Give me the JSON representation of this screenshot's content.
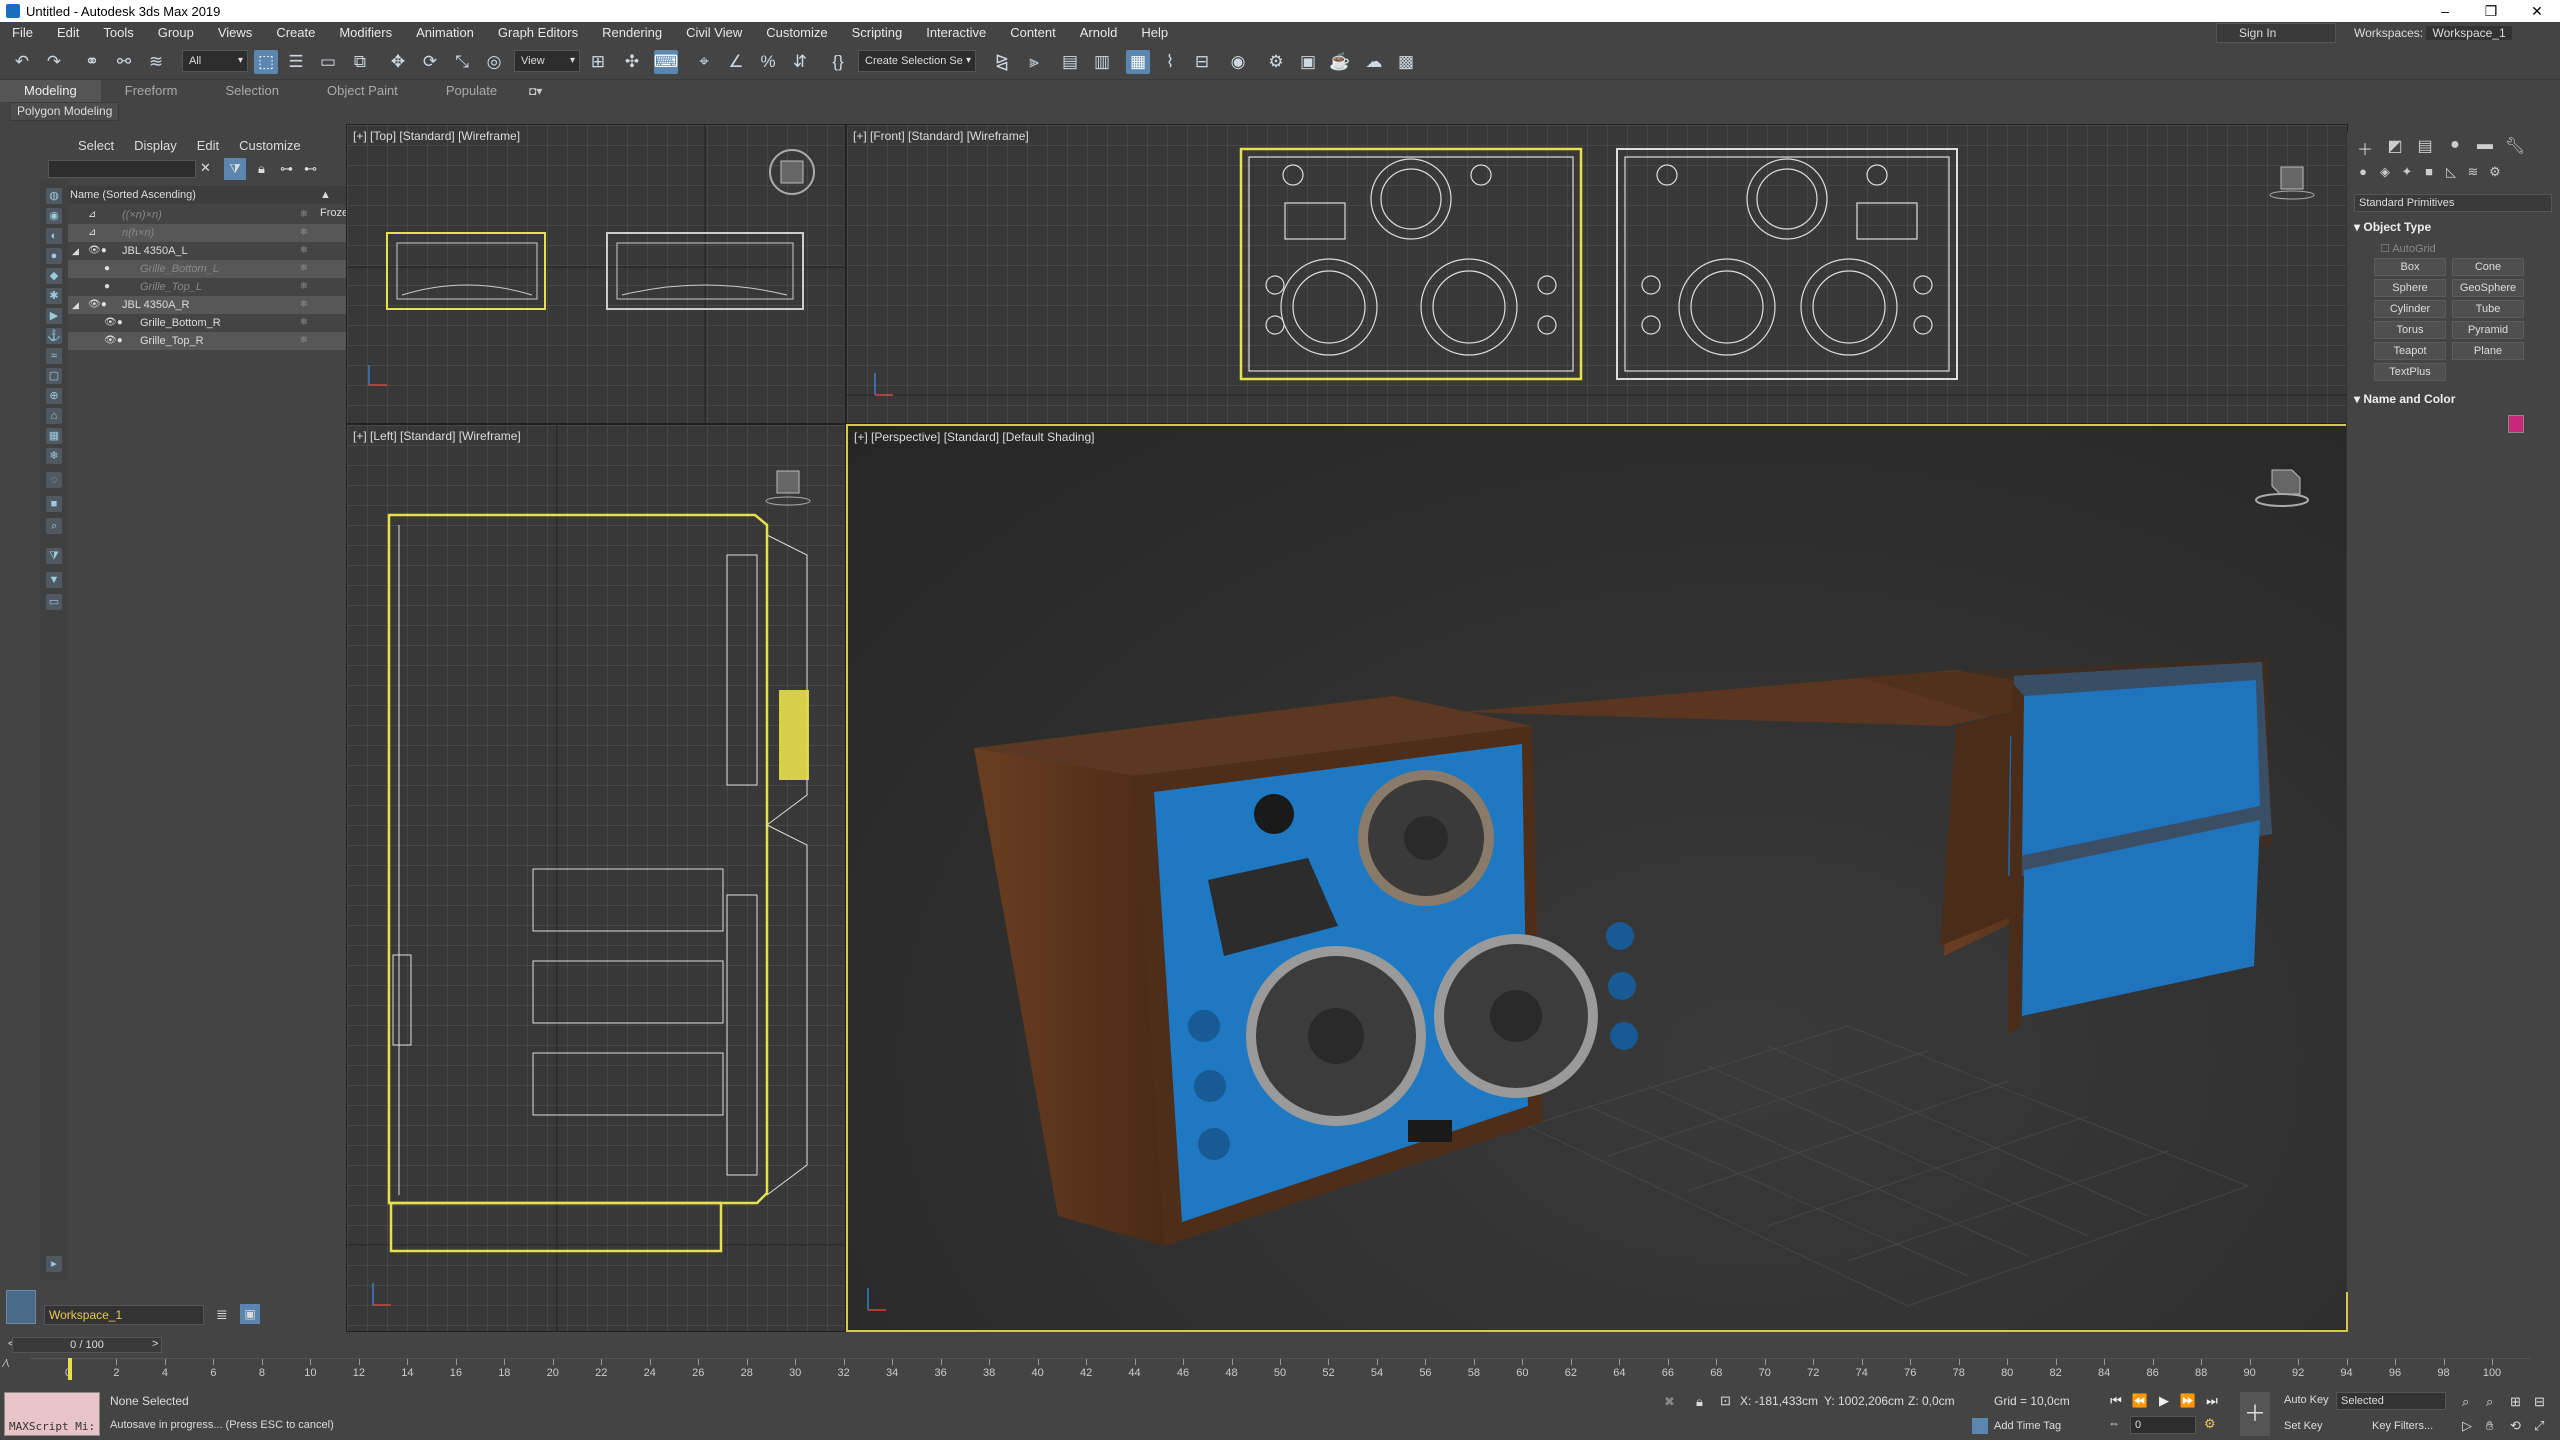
{
  "window": {
    "title": "Untitled - Autodesk 3ds Max 2019",
    "minimize": "–",
    "maximize": "❐",
    "close": "✕"
  },
  "menu": [
    "File",
    "Edit",
    "Tools",
    "Group",
    "Views",
    "Create",
    "Modifiers",
    "Animation",
    "Graph Editors",
    "Rendering",
    "Civil View",
    "Customize",
    "Scripting",
    "Interactive",
    "Content",
    "Arnold",
    "Help"
  ],
  "account": {
    "sign_in": "Sign In",
    "workspaces_label": "Workspaces:",
    "workspace": "Workspace_1"
  },
  "toolbar": {
    "selection_filter": "All",
    "ref_coord": "View",
    "named_selection": "Create Selection Se"
  },
  "ribbon": {
    "tabs": [
      "Modeling",
      "Freeform",
      "Selection",
      "Object Paint",
      "Populate"
    ],
    "active": "Modeling",
    "sub": "Polygon Modeling"
  },
  "scene_explorer": {
    "tabs": [
      "Select",
      "Display",
      "Edit",
      "Customize"
    ],
    "col_name": "Name (Sorted Ascending)",
    "col_frozen": "▲ Frozen",
    "rows": [
      {
        "label": "((×n)×n)",
        "dim": true
      },
      {
        "label": "n(h×n)",
        "dim": true
      },
      {
        "label": "JBL 4350A_L",
        "dim": false
      },
      {
        "label": "Grille_Bottom_L",
        "dim": true
      },
      {
        "label": "Grille_Top_L",
        "dim": true
      },
      {
        "label": "JBL 4350A_R",
        "dim": false
      },
      {
        "label": "Grille_Bottom_R",
        "dim": false
      },
      {
        "label": "Grille_Top_R",
        "dim": false
      }
    ],
    "workspace": "Workspace_1"
  },
  "viewports": {
    "top": "[+] [Top] [Standard] [Wireframe]",
    "front": "[+] [Front] [Standard] [Wireframe]",
    "left": "[+] [Left] [Standard] [Wireframe]",
    "persp": "[+] [Perspective] [Standard] [Default Shading]"
  },
  "command_panel": {
    "dropdown": "Standard Primitives",
    "object_type": "Object Type",
    "autogrid": "AutoGrid",
    "buttons": [
      "Box",
      "Cone",
      "Sphere",
      "GeoSphere",
      "Cylinder",
      "Tube",
      "Torus",
      "Pyramid",
      "Teapot",
      "Plane",
      "TextPlus"
    ],
    "name_color": "Name and Color",
    "color": "#c8277a"
  },
  "timeline": {
    "slider": "0 / 100",
    "ticks": [
      0,
      2,
      4,
      6,
      8,
      10,
      12,
      14,
      16,
      18,
      20,
      22,
      24,
      26,
      28,
      30,
      32,
      34,
      36,
      38,
      40,
      42,
      44,
      46,
      48,
      50,
      52,
      54,
      56,
      58,
      60,
      62,
      64,
      66,
      68,
      70,
      72,
      74,
      76,
      78,
      80,
      82,
      84,
      86,
      88,
      90,
      92,
      94,
      96,
      98,
      100
    ]
  },
  "status": {
    "maxscript": "MAXScript Mi:",
    "selected": "None Selected",
    "autosave": "Autosave in progress... (Press ESC to cancel)",
    "x": "X: -181,433cm",
    "y": "Y: 1002,206cm",
    "z": "Z: 0,0cm",
    "grid": "Grid = 10,0cm",
    "add_time_tag": "Add Time Tag",
    "auto_key": "Auto Key",
    "set_key": "Set Key",
    "selected_dd": "Selected",
    "key_filters": "Key Filters...",
    "frame": "0"
  }
}
